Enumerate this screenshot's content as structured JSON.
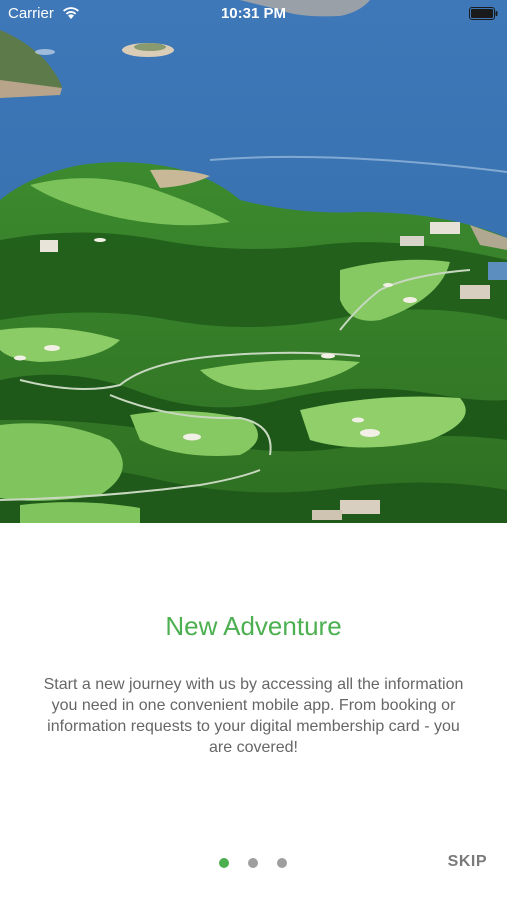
{
  "status_bar": {
    "carrier": "Carrier",
    "time": "10:31 PM",
    "wifi_icon": "wifi-icon",
    "battery_icon": "battery-full-icon"
  },
  "hero": {
    "image": "aerial view of a coastal golf course"
  },
  "onboarding": {
    "title": "New Adventure",
    "description": "Start a new journey with us by accessing all the information you need in one convenient mobile app. From booking or information requests to your digital membership card - you are covered!",
    "page_count": 3,
    "current_page": 1
  },
  "controls": {
    "skip_label": "SKIP"
  },
  "colors": {
    "accent": "#4caf50",
    "inactive_dot": "#9e9e9e",
    "body_text": "#666666",
    "skip_text": "#7a7a7a"
  }
}
